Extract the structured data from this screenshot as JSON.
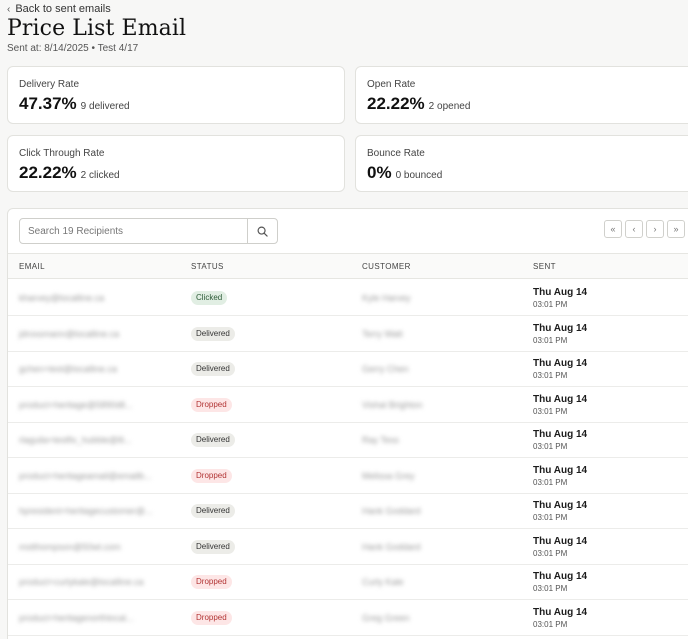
{
  "header": {
    "back_label": "Back to sent emails",
    "title": "Price List Email",
    "sent_meta": "Sent at: 8/14/2025 • Test 4/17"
  },
  "stats": [
    {
      "label": "Delivery Rate",
      "value": "47.37%",
      "sub": "9 delivered"
    },
    {
      "label": "Open Rate",
      "value": "22.22%",
      "sub": "2 opened"
    },
    {
      "label": "Click Through Rate",
      "value": "22.22%",
      "sub": "2 clicked"
    },
    {
      "label": "Bounce Rate",
      "value": "0%",
      "sub": "0 bounced"
    }
  ],
  "search": {
    "placeholder": "Search 19 Recipients"
  },
  "pager": {
    "first": "«",
    "prev": "‹",
    "next": "›",
    "last": "»"
  },
  "table": {
    "headers": {
      "email": "EMAIL",
      "status": "STATUS",
      "customer": "CUSTOMER",
      "sent": "SENT"
    },
    "rows": [
      {
        "email": "kharvey@localline.ca",
        "status": "Clicked",
        "customer": "Kyle Harvey",
        "sent_day": "Thu Aug 14",
        "sent_time": "03:01 PM"
      },
      {
        "email": "jdrossmann@localline.ca",
        "status": "Delivered",
        "customer": "Terry Watt",
        "sent_day": "Thu Aug 14",
        "sent_time": "03:01 PM"
      },
      {
        "email": "gchen+test@localline.ca",
        "status": "Delivered",
        "customer": "Gerry Chen",
        "sent_day": "Thu Aug 14",
        "sent_time": "03:01 PM"
      },
      {
        "email": "product+heritage@5890dll...",
        "status": "Dropped",
        "customer": "Vishal Brighton",
        "sent_day": "Thu Aug 14",
        "sent_time": "03:01 PM"
      },
      {
        "email": "rlaguila+testfix_hubble@lli...",
        "status": "Delivered",
        "customer": "Ray Tess",
        "sent_day": "Thu Aug 14",
        "sent_time": "03:01 PM"
      },
      {
        "email": "product+heritageamail@emailb...",
        "status": "Dropped",
        "customer": "Melissa Grey",
        "sent_day": "Thu Aug 14",
        "sent_time": "03:01 PM"
      },
      {
        "email": "hpresident+heritagecustomer@...",
        "status": "Delivered",
        "customer": "Hank Goddard",
        "sent_day": "Thu Aug 14",
        "sent_time": "03:01 PM"
      },
      {
        "email": "mstthompson@50wt.com",
        "status": "Delivered",
        "customer": "Hank Goddard",
        "sent_day": "Thu Aug 14",
        "sent_time": "03:01 PM"
      },
      {
        "email": "product+curlykale@localline.ca",
        "status": "Dropped",
        "customer": "Curly Kale",
        "sent_day": "Thu Aug 14",
        "sent_time": "03:01 PM"
      },
      {
        "email": "product+heritagenorthlocal...",
        "status": "Dropped",
        "customer": "Greg Green",
        "sent_day": "Thu Aug 14",
        "sent_time": "03:01 PM"
      }
    ]
  },
  "colors": {
    "clicked": "#2b5a36",
    "delivered": "#333333",
    "dropped": "#b23434"
  },
  "icons": {
    "back": "chevron-left-icon",
    "search": "search-icon"
  }
}
